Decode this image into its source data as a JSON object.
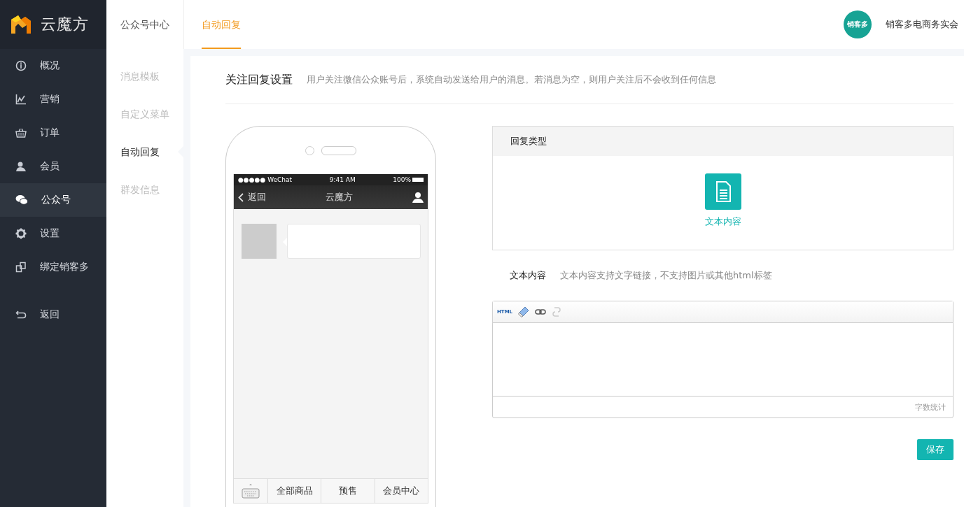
{
  "brand": {
    "name": "云魔方"
  },
  "sidebar": {
    "items": [
      {
        "label": "概况",
        "kind": "info",
        "selected": false
      },
      {
        "label": "营销",
        "kind": "chart",
        "selected": false
      },
      {
        "label": "订单",
        "kind": "basket",
        "selected": false
      },
      {
        "label": "会员",
        "kind": "person",
        "selected": false
      },
      {
        "label": "公众号",
        "kind": "chat",
        "selected": true
      },
      {
        "label": "设置",
        "kind": "gear",
        "selected": false
      },
      {
        "label": "绑定销客多",
        "kind": "link",
        "selected": false
      },
      {
        "label": "返回",
        "kind": "back",
        "selected": false
      }
    ]
  },
  "subnav": {
    "title": "公众号中心",
    "items": [
      {
        "label": "消息模板",
        "selected": false
      },
      {
        "label": "自定义菜单",
        "selected": false
      },
      {
        "label": "自动回复",
        "selected": true
      },
      {
        "label": "群发信息",
        "selected": false
      }
    ]
  },
  "tabs": [
    {
      "label": "自动回复",
      "selected": true
    }
  ],
  "user": {
    "avatar_text": "销客多",
    "name": "销客多电商务实会"
  },
  "section": {
    "title": "关注回复设置",
    "description": "用户关注微信公众账号后，系统自动发送给用户的消息。若消息为空，则用户关注后不会收到任何信息"
  },
  "phone": {
    "carrier": "●●●●● WeChat",
    "time": "9:41 AM",
    "battery": "100%",
    "back": "返回",
    "title": "云魔方",
    "menu": [
      "全部商品",
      "预售",
      "会员中心"
    ]
  },
  "reply_type": {
    "title": "回复类型",
    "options": [
      {
        "label": "文本内容",
        "selected": true
      }
    ]
  },
  "text_content": {
    "label": "文本内容",
    "hint": "文本内容支持文字链接，不支持图片或其他html标签",
    "toolbar_html": "HTML",
    "counter": "字数统计"
  },
  "save_button": "保存"
}
